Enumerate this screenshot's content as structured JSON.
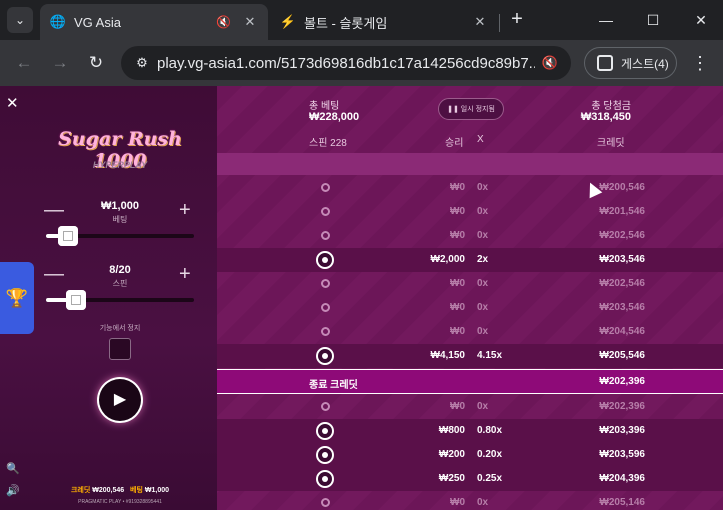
{
  "browser": {
    "tabs": [
      {
        "title": "VG Asia",
        "active": true
      },
      {
        "title": "볼트 - 슬롯게임",
        "active": false
      }
    ],
    "url": "play.vg-asia1.com/5173d69816db1c17a14256cd9c89b7...",
    "profile_label": "게스트(4)",
    "colors": {
      "frame": "#202124",
      "toolbar": "#35363a"
    }
  },
  "game": {
    "logo_text": "Sugar Rush 1000",
    "logo_sub": "HYPERPLAY",
    "bet": {
      "value": "₩1,000",
      "label": "베팅",
      "slider_fraction": 0.15
    },
    "spins": {
      "value": "8/20",
      "label": "스핀",
      "slider_fraction": 0.2
    },
    "stop_on_feature_label": "기능에서 정지",
    "bottom": {
      "credit_label": "크레딧",
      "credit_value": "₩200,546",
      "bet_label": "베팅",
      "bet_value": "₩1,000",
      "provider_line": "PRAGMATIC PLAY • #919328895441"
    },
    "colors": {
      "panel": "#4a1042",
      "table": "#6c1658",
      "accent": "#ffb000",
      "end_row": "#8e0a78"
    }
  },
  "history": {
    "total_bet_label": "총 베팅",
    "total_bet_value": "₩228,000",
    "total_win_label": "총 당첨금",
    "total_win_value": "₩318,450",
    "pause_label": "일시 정지됨",
    "columns": {
      "spins": "스핀 228",
      "win": "승리",
      "x": "X",
      "credit": "크레딧"
    },
    "rows": [
      {
        "won": false,
        "win": "₩0",
        "x": "0x",
        "credit": "₩200,546"
      },
      {
        "won": false,
        "win": "₩0",
        "x": "0x",
        "credit": "₩201,546"
      },
      {
        "won": false,
        "win": "₩0",
        "x": "0x",
        "credit": "₩202,546"
      },
      {
        "won": true,
        "win": "₩2,000",
        "x": "2x",
        "credit": "₩203,546"
      },
      {
        "won": false,
        "win": "₩0",
        "x": "0x",
        "credit": "₩202,546"
      },
      {
        "won": false,
        "win": "₩0",
        "x": "0x",
        "credit": "₩203,546"
      },
      {
        "won": false,
        "win": "₩0",
        "x": "0x",
        "credit": "₩204,546"
      },
      {
        "won": true,
        "win": "₩4,150",
        "x": "4.15x",
        "credit": "₩205,546"
      }
    ],
    "end_label": "종료 크레딧",
    "end_value": "₩202,396",
    "rows2": [
      {
        "won": false,
        "win": "₩0",
        "x": "0x",
        "credit": "₩202,396"
      },
      {
        "won": true,
        "win": "₩800",
        "x": "0.80x",
        "credit": "₩203,396"
      },
      {
        "won": true,
        "win": "₩200",
        "x": "0.20x",
        "credit": "₩203,596"
      },
      {
        "won": true,
        "win": "₩250",
        "x": "0.25x",
        "credit": "₩204,396"
      },
      {
        "won": false,
        "win": "₩0",
        "x": "0x",
        "credit": "₩205,146"
      }
    ]
  }
}
